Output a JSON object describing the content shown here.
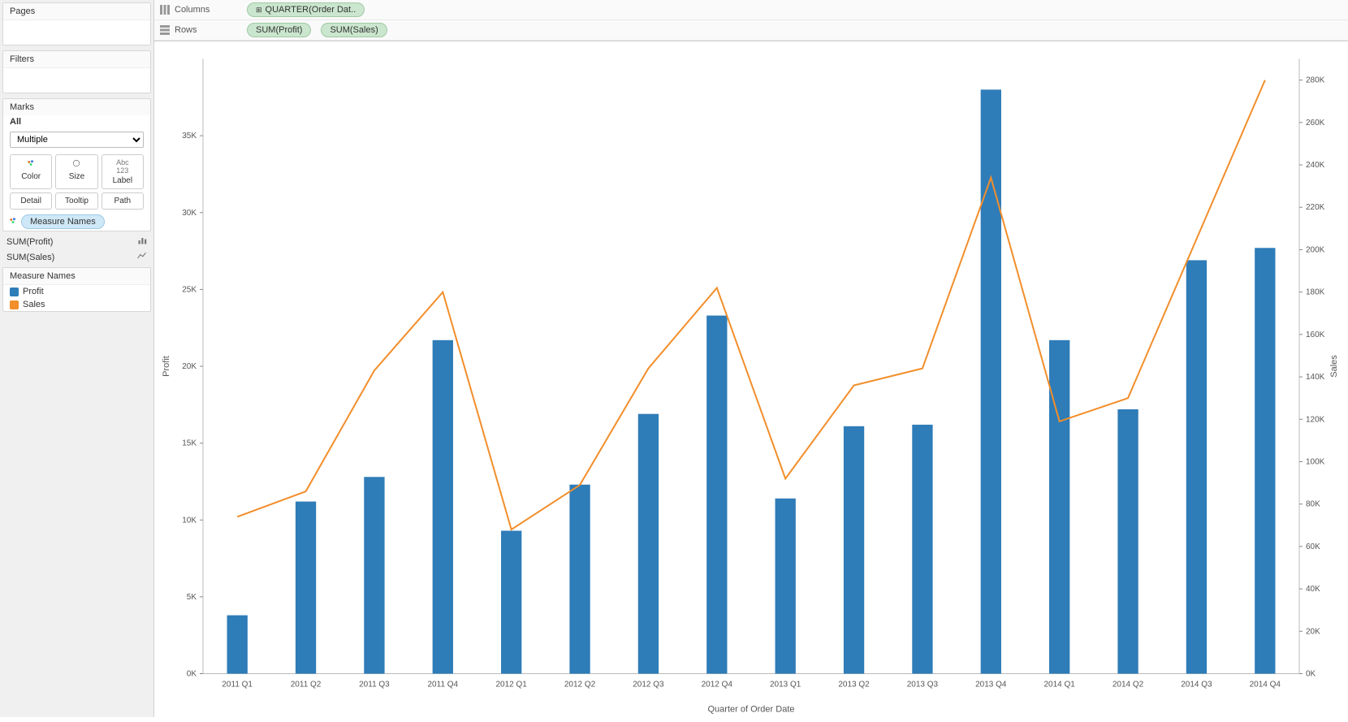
{
  "pages": {
    "title": "Pages"
  },
  "filters": {
    "title": "Filters"
  },
  "marks": {
    "title": "Marks",
    "all": "All",
    "dropdown": "Multiple",
    "buttons": {
      "color": "Color",
      "size": "Size",
      "label": "Label",
      "detail": "Detail",
      "tooltip": "Tooltip",
      "path": "Path"
    },
    "measure_names_pill": "Measure Names"
  },
  "measures": {
    "profit": "SUM(Profit)",
    "sales": "SUM(Sales)"
  },
  "legend": {
    "title": "Measure Names",
    "profit": "Profit",
    "sales": "Sales"
  },
  "columns_shelf": {
    "label": "Columns",
    "pill": "QUARTER(Order Dat.."
  },
  "rows_shelf": {
    "label": "Rows",
    "pill1": "SUM(Profit)",
    "pill2": "SUM(Sales)"
  },
  "chart_data": {
    "type": "bar",
    "xlabel": "Quarter of Order Date",
    "ylabel_left": "Profit",
    "ylabel_right": "Sales",
    "categories": [
      "2011 Q1",
      "2011 Q2",
      "2011 Q3",
      "2011 Q4",
      "2012 Q1",
      "2012 Q2",
      "2012 Q3",
      "2012 Q4",
      "2013 Q1",
      "2013 Q2",
      "2013 Q3",
      "2013 Q4",
      "2014 Q1",
      "2014 Q2",
      "2014 Q3",
      "2014 Q4"
    ],
    "series": [
      {
        "name": "Profit",
        "type": "bar",
        "axis": "left",
        "values": [
          3800,
          11200,
          12800,
          21700,
          9300,
          12300,
          16900,
          23300,
          11400,
          16100,
          16200,
          38000,
          21700,
          17200,
          26900,
          27700
        ]
      },
      {
        "name": "Sales",
        "type": "line",
        "axis": "right",
        "values": [
          74000,
          86000,
          143000,
          180000,
          68000,
          89000,
          144000,
          182000,
          92000,
          136000,
          144000,
          234000,
          119000,
          130000,
          205000,
          280000
        ]
      }
    ],
    "ylim_left": [
      0,
      40000
    ],
    "ylim_right": [
      0,
      290000
    ],
    "y_ticks_left": [
      0,
      5000,
      10000,
      15000,
      20000,
      25000,
      30000,
      35000
    ],
    "y_tick_labels_left": [
      "0K",
      "5K",
      "10K",
      "15K",
      "20K",
      "25K",
      "30K",
      "35K"
    ],
    "y_ticks_right": [
      0,
      20000,
      40000,
      60000,
      80000,
      100000,
      120000,
      140000,
      160000,
      180000,
      200000,
      220000,
      240000,
      260000,
      280000
    ],
    "y_tick_labels_right": [
      "0K",
      "20K",
      "40K",
      "60K",
      "80K",
      "100K",
      "120K",
      "140K",
      "160K",
      "180K",
      "200K",
      "220K",
      "240K",
      "260K",
      "280K"
    ]
  },
  "colors": {
    "bar": "#2e7cb8",
    "line": "#f28e2b"
  }
}
